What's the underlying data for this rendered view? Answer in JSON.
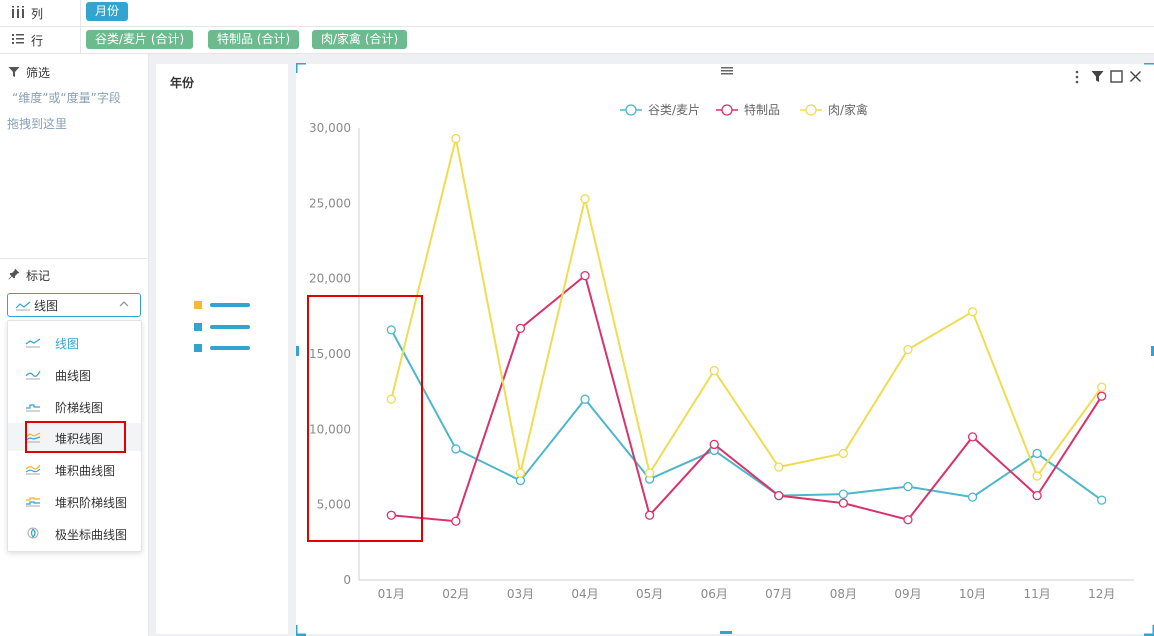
{
  "shelves": {
    "columns": {
      "icon": "columns-icon",
      "label": "列",
      "pills": [
        "月份"
      ]
    },
    "rows": {
      "icon": "rows-icon",
      "label": "行",
      "pills": [
        "谷类/麦片 (合计)",
        "特制品 (合计)",
        "肉/家禽 (合计)"
      ]
    }
  },
  "filter": {
    "icon": "filter-icon",
    "title": "筛选",
    "hint_line1": "“维度”或“度量”字段",
    "hint_line2": "拖拽到这里"
  },
  "marks": {
    "icon": "pin-icon",
    "title": "标记",
    "selected": "线图",
    "options": [
      "线图",
      "曲线图",
      "阶梯线图",
      "堆积线图",
      "堆积曲线图",
      "堆积阶梯线图",
      "极坐标曲线图"
    ],
    "active_option": "线图",
    "highlighted_option": "堆积线图"
  },
  "legend_panel": {
    "title": "年份"
  },
  "toolbar_icons": [
    "drag-handle-icon",
    "more-icon",
    "filter-icon",
    "maximize-icon",
    "close-icon"
  ],
  "chart_data": {
    "type": "line",
    "categories": [
      "01月",
      "02月",
      "03月",
      "04月",
      "05月",
      "06月",
      "07月",
      "08月",
      "09月",
      "10月",
      "11月",
      "12月"
    ],
    "series": [
      {
        "name": "谷类/麦片",
        "color": "#4cb7cb",
        "values": [
          16600,
          8700,
          6600,
          12000,
          6700,
          8600,
          5600,
          5700,
          6200,
          5500,
          8400,
          5300
        ]
      },
      {
        "name": "特制品",
        "color": "#d9326a",
        "values": [
          4300,
          3900,
          16700,
          20200,
          4300,
          9000,
          5600,
          5100,
          4000,
          9500,
          5600,
          12200
        ]
      },
      {
        "name": "肉/家禽",
        "color": "#f0dc52",
        "values": [
          12000,
          29300,
          7100,
          25300,
          7100,
          13900,
          7500,
          8400,
          15300,
          17800,
          6900,
          12800
        ]
      }
    ],
    "ylim": [
      0,
      30000
    ],
    "yticks": [
      "0",
      "5,000",
      "10,000",
      "15,000",
      "20,000",
      "25,000",
      "30,000"
    ],
    "legend_position": "top-center",
    "grid": false
  },
  "colors": {
    "accent": "#33a4cf",
    "pill_green": "#6dba8e",
    "highlight": "#e00000"
  }
}
